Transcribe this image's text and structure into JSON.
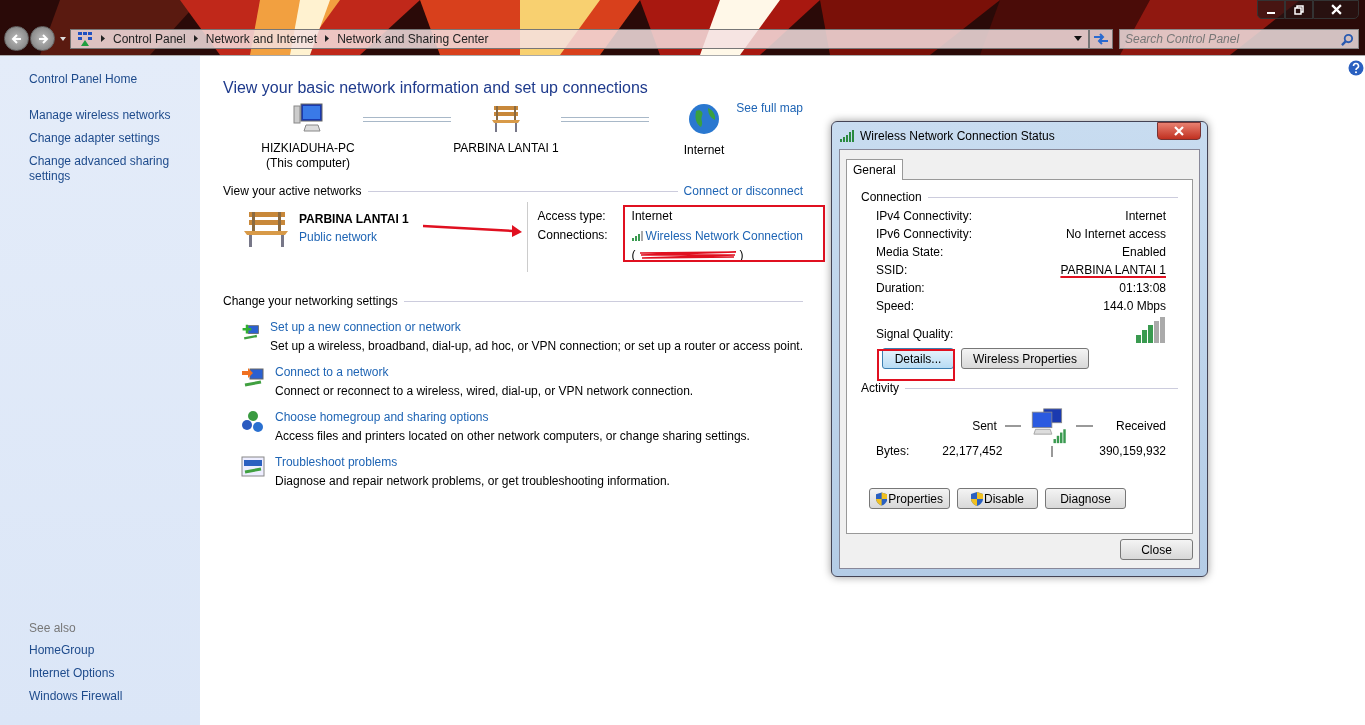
{
  "nav": {
    "breadcrumb": [
      "Control Panel",
      "Network and Internet",
      "Network and Sharing Center"
    ],
    "search": {
      "placeholder": "Search Control Panel"
    }
  },
  "sidebar": {
    "items": [
      "Control Panel Home",
      "Manage wireless networks",
      "Change adapter settings",
      "Change advanced sharing settings"
    ],
    "see_also_title": "See also",
    "see_also": [
      "HomeGroup",
      "Internet Options",
      "Windows Firewall"
    ]
  },
  "main": {
    "title": "View your basic network information and set up connections",
    "see_full_map": "See full map",
    "map_nodes": [
      {
        "kind": "computer",
        "label": "HIZKIADUHA-PC",
        "sublabel": "(This computer)"
      },
      {
        "kind": "bench",
        "label": "PARBINA LANTAI 1"
      },
      {
        "kind": "globe",
        "label": "Internet"
      }
    ],
    "active_networks": {
      "heading": "View your active networks",
      "link": "Connect or disconnect",
      "name": "PARBINA LANTAI 1",
      "type": "Public network",
      "access_type_label": "Access type:",
      "access_type": "Internet",
      "connections_label": "Connections:",
      "connection": "Wireless Network Connection",
      "paren_open": "(",
      "paren_close": ")"
    },
    "settings": {
      "heading": "Change your networking settings",
      "tasks": [
        {
          "kind": "new-connection",
          "title": "Set up a new connection or network",
          "description": "Set up a wireless, broadband, dial-up, ad hoc, or VPN connection; or set up a router or access point."
        },
        {
          "kind": "connect",
          "title": "Connect to a network",
          "description": "Connect or reconnect to a wireless, wired, dial-up, or VPN network connection."
        },
        {
          "kind": "homegroup",
          "title": "Choose homegroup and sharing options",
          "description": "Access files and printers located on other network computers, or change sharing settings."
        },
        {
          "kind": "troubleshoot",
          "title": "Troubleshoot problems",
          "description": "Diagnose and repair network problems, or get troubleshooting information."
        }
      ]
    }
  },
  "dialog": {
    "title": "Wireless Network Connection Status",
    "tabs": [
      {
        "label": "General",
        "selected": true
      }
    ],
    "connection_heading": "Connection",
    "rows": [
      {
        "label": "IPv4 Connectivity:",
        "value": "Internet",
        "struck": false
      },
      {
        "label": "IPv6 Connectivity:",
        "value": "No Internet access",
        "struck": false
      },
      {
        "label": "Media State:",
        "value": "Enabled",
        "struck": false
      },
      {
        "label": "SSID:",
        "value": "PARBINA LANTAI 1",
        "struck": true
      },
      {
        "label": "Duration:",
        "value": "01:13:08",
        "struck": false
      },
      {
        "label": "Speed:",
        "value": "144.0 Mbps",
        "struck": false
      }
    ],
    "signal_label": "Signal Quality:",
    "buttons": [
      {
        "label": "Details...",
        "selected": true
      },
      {
        "label": "Wireless Properties",
        "selected": false
      }
    ],
    "activity_heading": "Activity",
    "sent_label": "Sent",
    "received_label": "Received",
    "bytes_label": "Bytes:",
    "bytes_sent": "22,177,452",
    "bytes_received": "390,159,932",
    "action_buttons": [
      {
        "label": "Properties",
        "shield": true
      },
      {
        "label": "Disable",
        "shield": true
      },
      {
        "label": "Diagnose",
        "shield": false
      }
    ],
    "close": "Close"
  }
}
